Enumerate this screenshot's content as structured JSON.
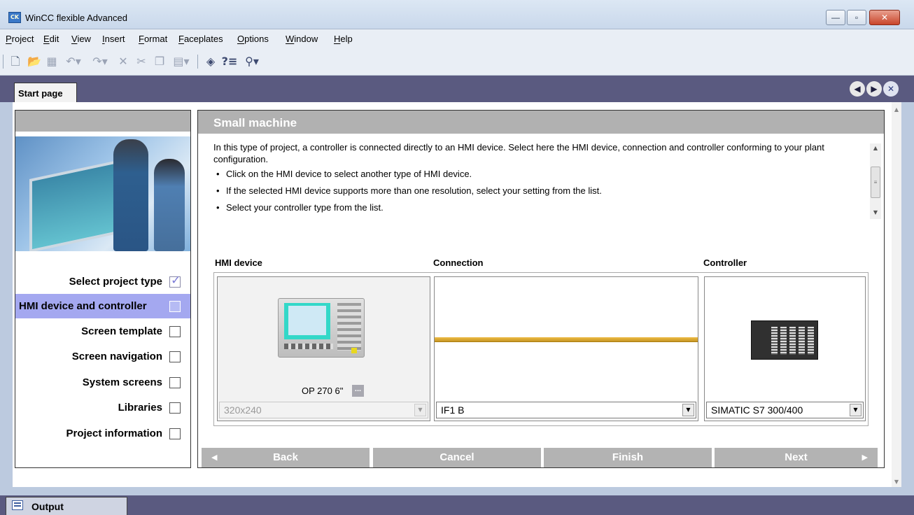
{
  "window": {
    "title": "WinCC flexible Advanced",
    "app_icon_text": "CK",
    "minimize_glyph": "—",
    "maximize_glyph": "▫",
    "close_glyph": "✕"
  },
  "menu": [
    "Project",
    "Edit",
    "View",
    "Insert",
    "Format",
    "Faceplates",
    "Options",
    "Window",
    "Help"
  ],
  "toolbar": {
    "icons": [
      "new-file-icon",
      "open-folder-icon",
      "save-icon",
      "undo-icon",
      "redo-icon",
      "delete-icon",
      "cut-icon",
      "copy-icon",
      "paste-icon",
      "help-book-icon",
      "help-topics-icon",
      "context-help-icon"
    ]
  },
  "tabs": {
    "start_page": "Start page",
    "nav_prev": "◀",
    "nav_next": "▶",
    "nav_close": "✕"
  },
  "steps": [
    {
      "label": "Select project type",
      "state": "done"
    },
    {
      "label": "HMI device and controller",
      "state": "active"
    },
    {
      "label": "Screen template",
      "state": "pending"
    },
    {
      "label": "Screen navigation",
      "state": "pending"
    },
    {
      "label": "System screens",
      "state": "pending"
    },
    {
      "label": "Libraries",
      "state": "pending"
    },
    {
      "label": "Project information",
      "state": "pending"
    }
  ],
  "main": {
    "title": "Small machine",
    "description": "In this type of project, a controller is connected directly to an HMI device. Select here the HMI device, connection and controller conforming to your plant configuration.",
    "bullets": [
      "Click on the HMI device to select another type of HMI device.",
      "If the selected HMI device supports more than one resolution, select your setting from the list.",
      "Select your controller type from the list."
    ],
    "columns": {
      "hmi": "HMI device",
      "connection": "Connection",
      "controller": "Controller"
    },
    "hmi_device_name": "OP 270 6\"",
    "more_button": "...",
    "resolution_value": "320x240",
    "connection_value": "IF1 B",
    "controller_value": "SIMATIC S7 300/400"
  },
  "nav_buttons": {
    "back": "Back",
    "cancel": "Cancel",
    "finish": "Finish",
    "next": "Next",
    "back_arrow": "◀",
    "next_arrow": "▶"
  },
  "output": {
    "tab_label": "Output"
  },
  "colors": {
    "tab_strip": "#5a5a80",
    "active_step": "#a4a8f0",
    "panel_header": "#b1b1b1",
    "connection_line": "#d8a732",
    "hmi_screen_frame": "#33d8c8"
  }
}
